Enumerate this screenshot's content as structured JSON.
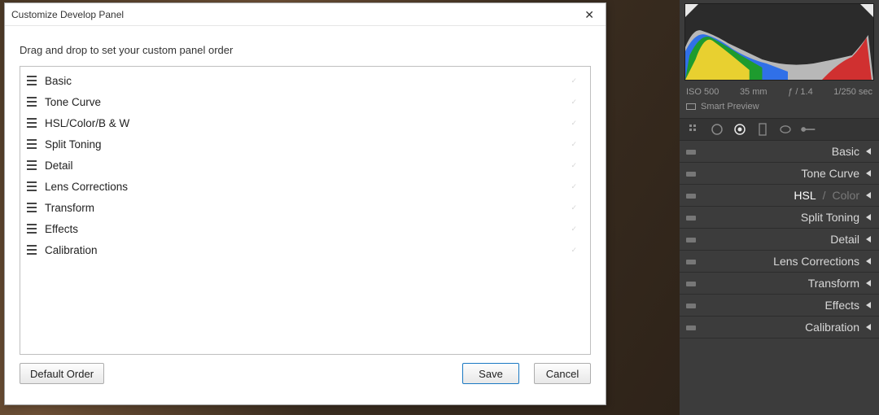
{
  "dialog": {
    "title": "Customize Develop Panel",
    "close_glyph": "✕",
    "instruction": "Drag and drop to set your custom panel order",
    "rows": [
      {
        "label": "Basic"
      },
      {
        "label": "Tone Curve"
      },
      {
        "label": "HSL/Color/B & W"
      },
      {
        "label": "Split Toning"
      },
      {
        "label": "Detail"
      },
      {
        "label": "Lens Corrections"
      },
      {
        "label": "Transform"
      },
      {
        "label": "Effects"
      },
      {
        "label": "Calibration"
      }
    ],
    "buttons": {
      "default_order": "Default Order",
      "save": "Save",
      "cancel": "Cancel"
    }
  },
  "sidebar": {
    "histogram": {
      "clip_left_on": true,
      "clip_right_on": true
    },
    "meta": {
      "iso": "ISO 500",
      "focal": "35 mm",
      "aperture": "ƒ / 1.4",
      "shutter": "1/250 sec"
    },
    "smart_preview": "Smart Preview",
    "toolstrip": {
      "crop": "crop-icon",
      "spot": "spot-removal-icon",
      "redeye": "red-eye-icon",
      "graduated": "graduated-filter-icon",
      "radial": "radial-filter-icon",
      "brush": "adjustment-brush-icon"
    },
    "panels": [
      {
        "label": "Basic"
      },
      {
        "label": "Tone Curve"
      },
      {
        "label_main": "HSL",
        "label_sep": " / ",
        "label_sub": "Color",
        "hsl": true
      },
      {
        "label": "Split Toning"
      },
      {
        "label": "Detail"
      },
      {
        "label": "Lens Corrections"
      },
      {
        "label": "Transform"
      },
      {
        "label": "Effects"
      },
      {
        "label": "Calibration"
      }
    ]
  }
}
